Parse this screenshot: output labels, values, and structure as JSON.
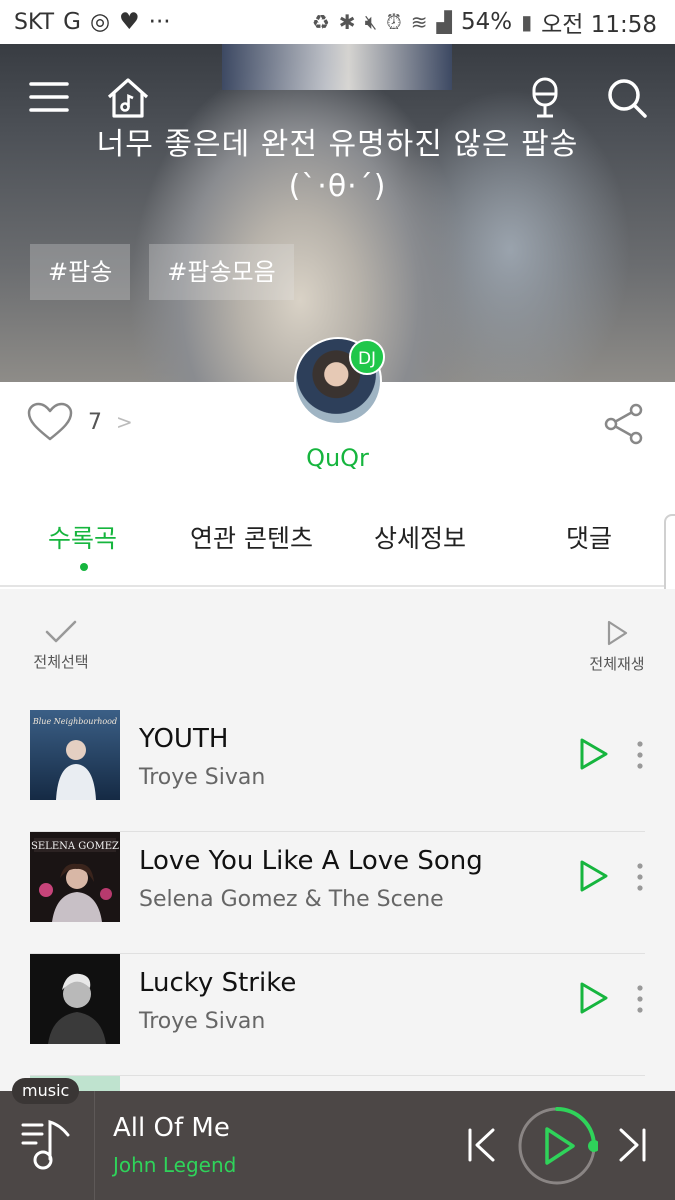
{
  "status_bar": {
    "carrier": "SKT",
    "battery": "54%",
    "time": "오전 11:58"
  },
  "hero": {
    "title_line1": "너무 좋은데 완전 유명하진 않은 팝송",
    "title_line2": "(`·θ·´)",
    "tags": [
      "#팝송",
      "#팝송모음"
    ]
  },
  "dj": {
    "badge": "DJ",
    "name": "QuQr"
  },
  "likes": {
    "count": "7",
    "chevron": ">"
  },
  "tabs": [
    {
      "label": "수록곡",
      "active": true
    },
    {
      "label": "연관 콘텐츠",
      "active": false
    },
    {
      "label": "상세정보",
      "active": false
    },
    {
      "label": "댓글",
      "active": false
    }
  ],
  "list_controls": {
    "select_all": "전체선택",
    "play_all": "전체재생"
  },
  "tracks": [
    {
      "title": "YOUTH",
      "artist": "Troye Sivan"
    },
    {
      "title": "Love You Like A Love Song",
      "artist": "Selena Gomez & The Scene"
    },
    {
      "title": "Lucky Strike",
      "artist": "Troye Sivan"
    }
  ],
  "player": {
    "pill": "music",
    "title": "All Of Me",
    "artist": "John Legend",
    "progress": 0.25
  },
  "colors": {
    "accent": "#16b53e",
    "player_bg": "#4c4746"
  }
}
